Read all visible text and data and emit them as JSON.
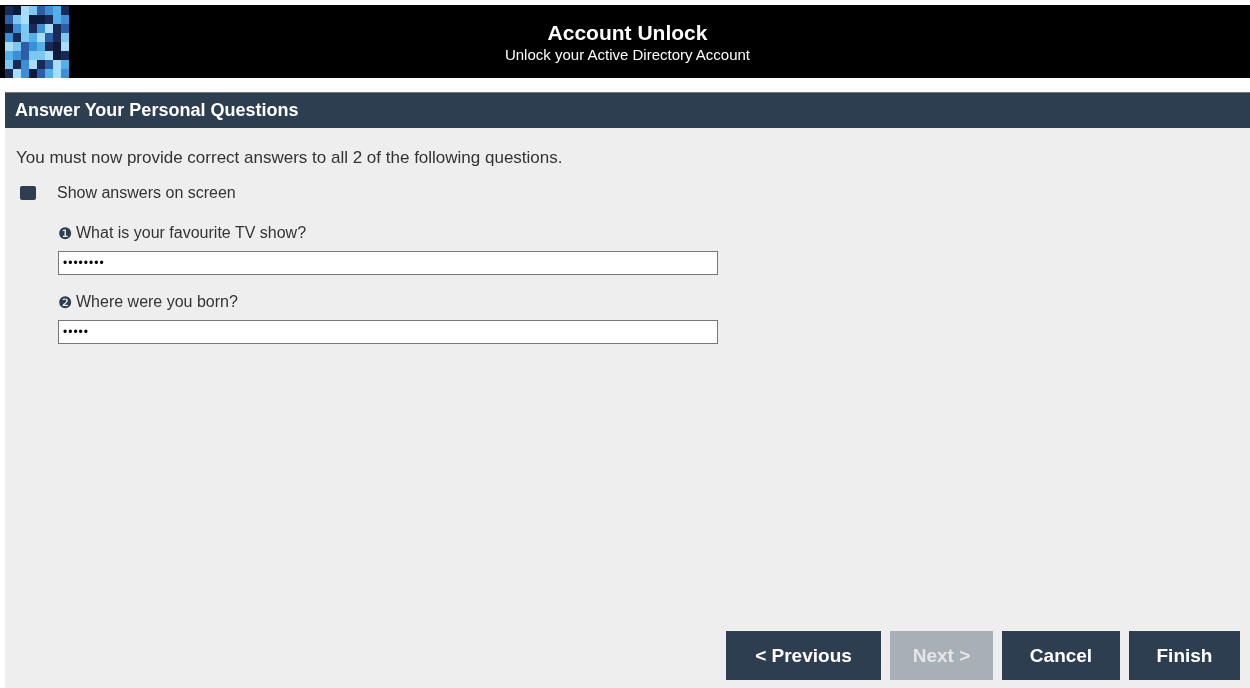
{
  "header": {
    "title": "Account Unlock",
    "subtitle": "Unlock your Active Directory Account"
  },
  "section": {
    "title": "Answer Your Personal Questions"
  },
  "instruction": "You must now provide correct answers to all 2 of the following questions.",
  "show_answers": {
    "label": "Show answers on screen",
    "checked": false
  },
  "questions": [
    {
      "number": "❶",
      "label": "What is your favourite TV show?",
      "value": "••••••••"
    },
    {
      "number": "❷",
      "label": "Where were you born?",
      "value": "•••••"
    }
  ],
  "buttons": [
    {
      "label": "< Previous",
      "disabled": false
    },
    {
      "label": "Next >",
      "disabled": true
    },
    {
      "label": "Cancel",
      "disabled": false
    },
    {
      "label": "Finish",
      "disabled": false
    }
  ]
}
